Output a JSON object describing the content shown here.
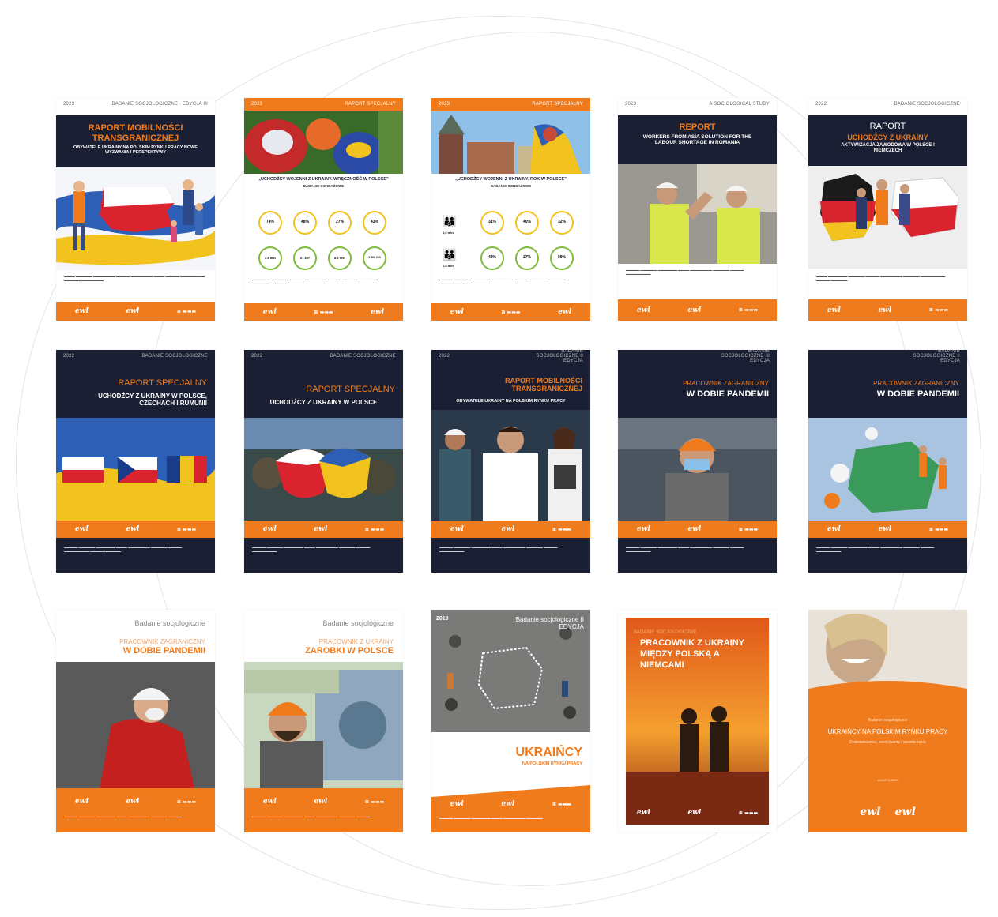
{
  "colors": {
    "orange": "#f07b1d",
    "navy": "#1b1f34",
    "yellow": "#f2c21e",
    "blue": "#2c5fb5",
    "red": "#d9232f"
  },
  "logo_text": "ewl",
  "cards": [
    {
      "year": "2023",
      "series": "BADANIE SOCJOLOGICZNE · EDYCJA III",
      "title": "RAPORT MOBILNOŚCI TRANSGRANICZNEJ",
      "subtitle": "OBYWATELE UKRAINY NA POLSKIM RYNKU PRACY NOWE WYZWANIA I PERSPEKTYWY"
    },
    {
      "year": "2023",
      "series": "RAPORT SPECJALNY",
      "title": "„UCHODŹCY WOJENNI Z UKRAINY. WRĘCZNOŚĆ W POLSCE”",
      "subtitle": "BADANIE SONDAŻOWE",
      "stats": [
        "74%",
        "48%",
        "27%",
        "43%",
        "2.5 mln",
        "21 397",
        "8.6 mln",
        "1 800 000"
      ]
    },
    {
      "year": "2023",
      "series": "RAPORT SPECJALNY",
      "title": "„UCHODŹCY WOJENNI Z UKRAINY. ROK W POLSCE”",
      "subtitle": "BADANIE SONDAŻOWE",
      "stats": [
        "1,6 mln",
        "0,8 mln",
        "31%",
        "40%",
        "32%",
        "42%",
        "27%",
        "89%"
      ]
    },
    {
      "year": "2023",
      "series": "A SOCIOLOGICAL STUDY",
      "title": "REPORT",
      "subtitle": "WORKERS FROM ASIA SOLUTION FOR THE LABOUR SHORTAGE IN ROMANIA"
    },
    {
      "year": "2022",
      "series": "BADANIE SOCJOLOGICZNE",
      "title": "RAPORT",
      "subtitle": "UCHODŹCY Z UKRAINY",
      "sub2": "AKTYWIZACJA ZAWODOWA W POLSCE I NIEMCZECH"
    },
    {
      "year": "2022",
      "series": "BADANIE SOCJOLOGICZNE",
      "title": "RAPORT SPECJALNY",
      "subtitle": "UCHODŹCY Z UKRAINY W POLSCE, CZECHACH I RUMUNII"
    },
    {
      "year": "2022",
      "series": "BADANIE SOCJOLOGICZNE",
      "title": "RAPORT SPECJALNY",
      "subtitle": "UCHODŹCY Z UKRAINY W POLSCE"
    },
    {
      "year": "2022",
      "series": "BADANIE SOCJOLOGICZNE II EDYCJA",
      "title": "RAPORT MOBILNOŚCI TRANSGRANICZNEJ",
      "subtitle": "OBYWATELE UKRAINY NA POLSKIM RYNKU PRACY"
    },
    {
      "year": "",
      "series": "BADANIE SOCJOLOGICZNE III EDYCJA",
      "title": "PRACOWNIK ZAGRANICZNY",
      "subtitle": "W DOBIE PANDEMII"
    },
    {
      "year": "",
      "series": "BADANIE SOCJOLOGICZNE II EDYCJA",
      "title": "PRACOWNIK ZAGRANICZNY",
      "subtitle": "W DOBIE PANDEMII"
    },
    {
      "series": "Badanie socjologiczne",
      "title": "PRACOWNIK ZAGRANICZNY",
      "subtitle": "W DOBIE PANDEMII"
    },
    {
      "series": "Badanie socjologiczne",
      "title": "PRACOWNIK Z UKRAINY",
      "subtitle": "ZAROBKI W POLSCE"
    },
    {
      "year": "2019",
      "series": "Badanie socjologiczne II EDYCJA",
      "title": "UKRAIŃCY",
      "subtitle": "NA POLSKIM RYNKU PRACY"
    },
    {
      "series": "BADANIE SOCJOLOGICZNE",
      "title": "PRACOWNIK Z UKRAINY MIĘDZY POLSKĄ A NIEMCAMI"
    },
    {
      "series": "Badanie socjologiczne",
      "title": "UKRAIŃCY NA POLSKIM RYNKU PRACY",
      "subtitle": "Doświadczenia, oczekiwania i sposób życia",
      "edition": "ANKIETA 2017"
    }
  ]
}
